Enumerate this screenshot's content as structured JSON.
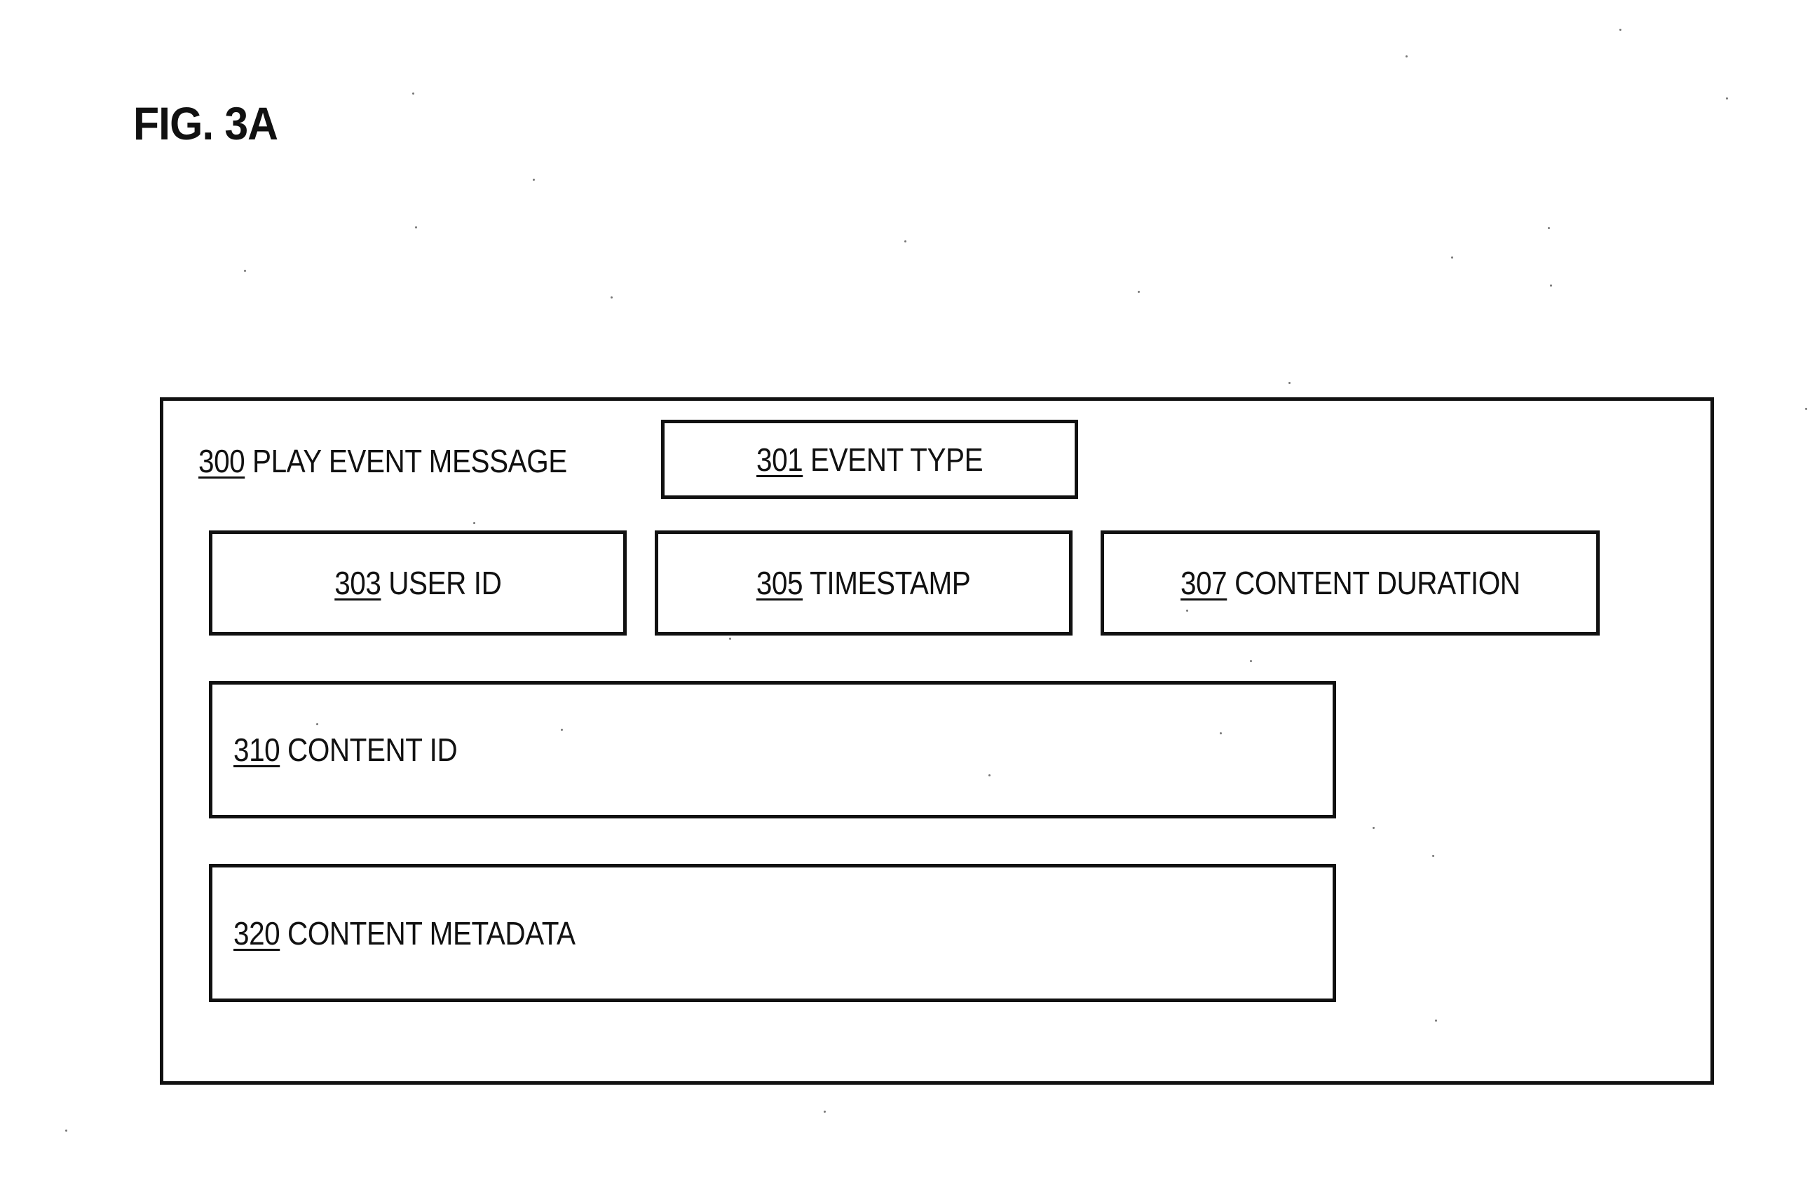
{
  "figure": {
    "title": "FIG. 3A"
  },
  "diagram": {
    "message": {
      "ref": "300",
      "label": "PLAY EVENT MESSAGE"
    },
    "fields": {
      "event_type": {
        "ref": "301",
        "label": "EVENT TYPE"
      },
      "user_id": {
        "ref": "303",
        "label": "USER ID"
      },
      "timestamp": {
        "ref": "305",
        "label": "TIMESTAMP"
      },
      "content_duration": {
        "ref": "307",
        "label": "CONTENT DURATION"
      },
      "content_id": {
        "ref": "310",
        "label": "CONTENT ID"
      },
      "content_metadata": {
        "ref": "320",
        "label": "CONTENT METADATA"
      }
    }
  },
  "colors": {
    "ink": "#111111",
    "background": "#ffffff"
  }
}
